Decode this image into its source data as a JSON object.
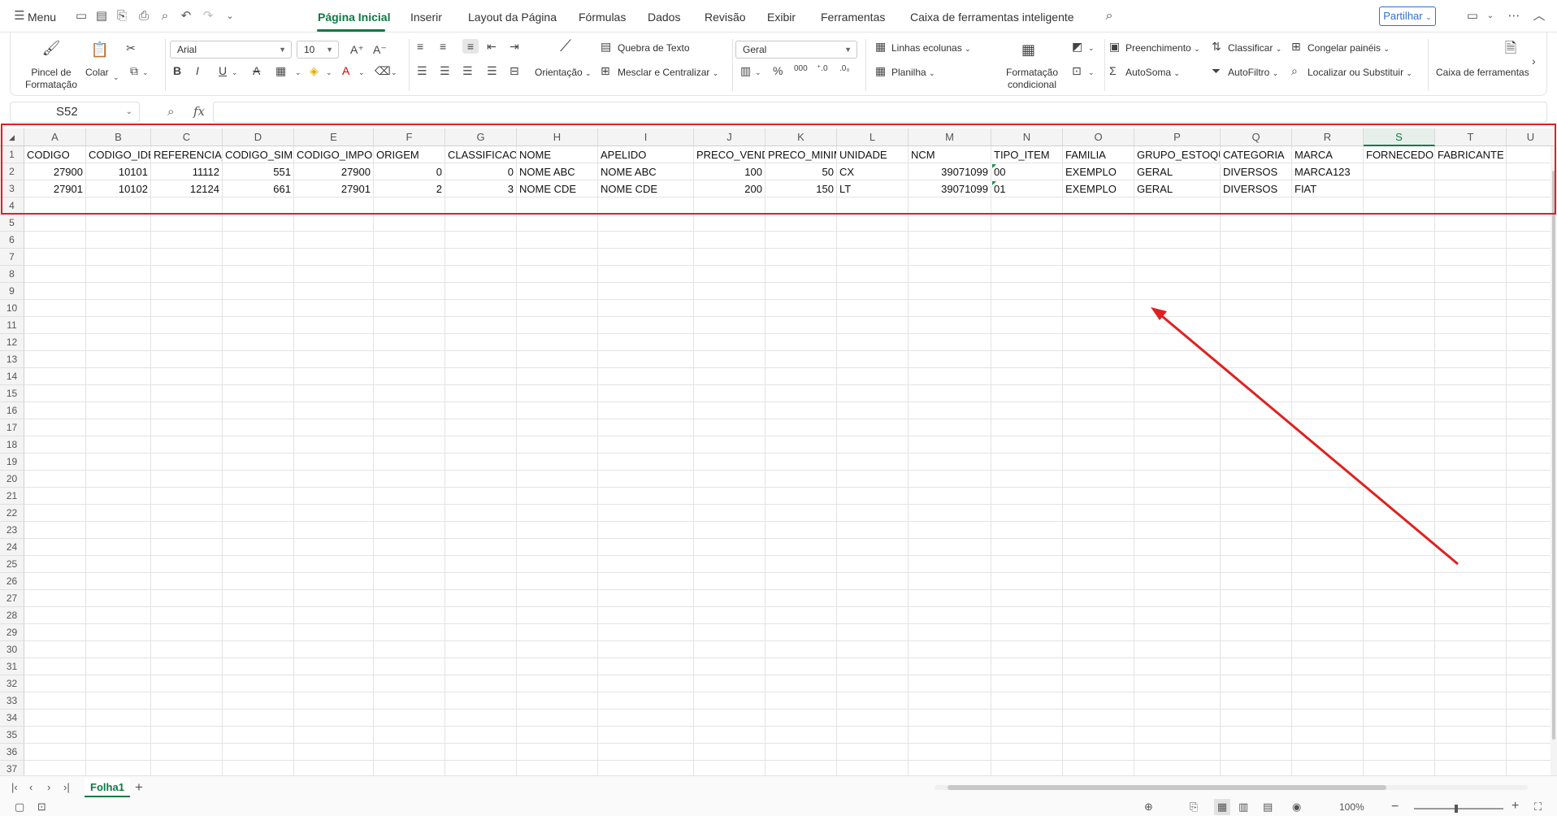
{
  "menubar": {
    "menu_label": "Menu",
    "tabs": [
      "Página Inicial",
      "Inserir",
      "Layout da Página",
      "Fórmulas",
      "Dados",
      "Revisão",
      "Exibir",
      "Ferramentas",
      "Caixa de ferramentas inteligente"
    ],
    "active_tab": "Página Inicial",
    "share_label": "Partilhar"
  },
  "ribbon": {
    "format_painter": "Pincel de Formatação",
    "paste": "Colar",
    "font_name": "Arial",
    "font_size": "10",
    "wrap_text": "Quebra de Texto",
    "orientation": "Orientação",
    "merge_center": "Mesclar e Centralizar",
    "number_format": "Geral",
    "rows_columns": "Linhas ecolunas",
    "sheet": "Planilha",
    "conditional_format": "Formatação condicional",
    "fill": "Preenchimento",
    "autosum": "AutoSoma",
    "sort": "Classificar",
    "autofilter": "AutoFiltro",
    "freeze": "Congelar painéis",
    "find_replace": "Localizar ou Substituir",
    "toolbox": "Caixa de ferramentas"
  },
  "formula_bar": {
    "name_box": "S52",
    "formula": ""
  },
  "sheet": {
    "columns": [
      "A",
      "B",
      "C",
      "D",
      "E",
      "F",
      "G",
      "H",
      "I",
      "J",
      "K",
      "L",
      "M",
      "N",
      "O",
      "P",
      "Q",
      "R",
      "S",
      "T",
      "U"
    ],
    "selected_column": "S",
    "row_numbers": [
      "1",
      "2",
      "3",
      "4",
      "5",
      "6",
      "7",
      "8",
      "9",
      "10",
      "11",
      "12",
      "13",
      "14",
      "15",
      "16",
      "17",
      "18",
      "19",
      "20",
      "21",
      "22",
      "23",
      "24",
      "25",
      "26",
      "27",
      "28",
      "29",
      "30",
      "31",
      "32",
      "33",
      "34",
      "35",
      "36",
      "37"
    ],
    "rows": [
      [
        "CODIGO",
        "CODIGO_IDE",
        "REFERENCIA_I",
        "CODIGO_SIMI",
        "CODIGO_IMPOI",
        "ORIGEM",
        "CLASSIFICACA",
        "NOME",
        "APELIDO",
        "PRECO_VEND/",
        "PRECO_MINIM",
        "UNIDADE",
        "NCM",
        "TIPO_ITEM",
        "FAMILIA",
        "GRUPO_ESTOQU",
        "CATEGORIA",
        "MARCA",
        "FORNECEDOR",
        "FABRICANTE",
        ""
      ],
      [
        "27900",
        "10101",
        "11112",
        "551",
        "27900",
        "0",
        "0",
        "NOME ABC",
        "NOME ABC",
        "100",
        "50",
        "CX",
        "39071099",
        "00",
        "EXEMPLO",
        "GERAL",
        "DIVERSOS",
        "MARCA123",
        "",
        "",
        ""
      ],
      [
        "27901",
        "10102",
        "12124",
        "661",
        "27901",
        "2",
        "3",
        "NOME CDE",
        "NOME CDE",
        "200",
        "150",
        "LT",
        "39071099",
        "01",
        "EXEMPLO",
        "GERAL",
        "DIVERSOS",
        "FIAT",
        "",
        "",
        ""
      ]
    ],
    "numeric_columns": [
      0,
      1,
      2,
      3,
      4,
      5,
      6,
      9,
      10,
      12
    ]
  },
  "statusbar": {
    "sheet_tab": "Folha1",
    "zoom": "100%"
  },
  "colors": {
    "accent": "#0e7a45",
    "annotation": "#e02020",
    "share": "#2f6fd8"
  }
}
